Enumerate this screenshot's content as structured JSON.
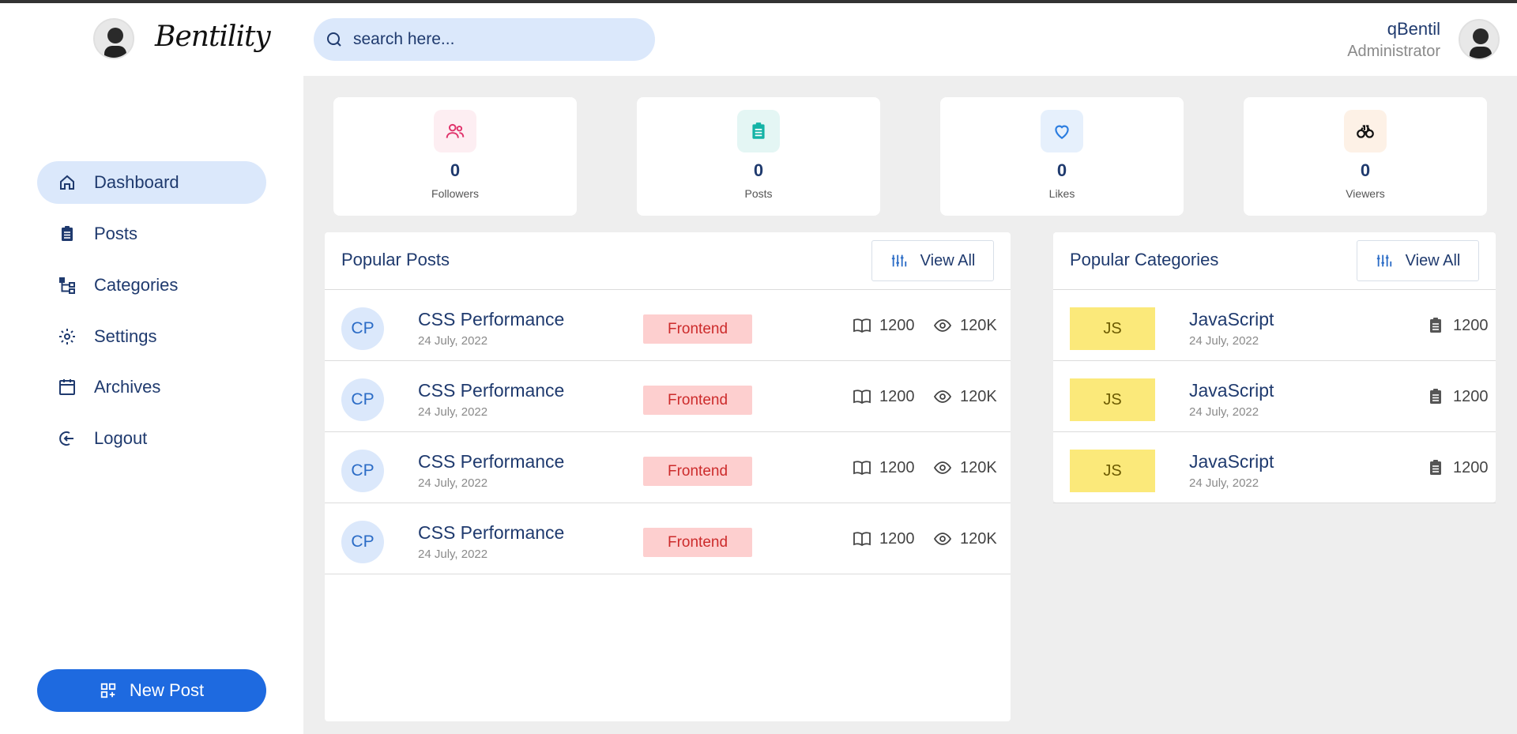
{
  "brand": {
    "name": "Bentility"
  },
  "search": {
    "placeholder": "search here..."
  },
  "user": {
    "name": "qBentil",
    "role": "Administrator"
  },
  "sidebar": {
    "items": [
      {
        "label": "Dashboard",
        "icon": "home-icon",
        "active": true
      },
      {
        "label": "Posts",
        "icon": "clipboard-icon"
      },
      {
        "label": "Categories",
        "icon": "tree-icon"
      },
      {
        "label": "Settings",
        "icon": "gear-icon"
      },
      {
        "label": "Archives",
        "icon": "calendar-icon"
      },
      {
        "label": "Logout",
        "icon": "logout-icon"
      }
    ],
    "new_post_label": "New Post"
  },
  "stats": [
    {
      "value": "0",
      "label": "Followers",
      "icon": "users-icon",
      "color": "#e0336b",
      "bg": "#fdeef2"
    },
    {
      "value": "0",
      "label": "Posts",
      "icon": "clipboard-icon",
      "color": "#14b3a6",
      "bg": "#e4f6f4"
    },
    {
      "value": "0",
      "label": "Likes",
      "icon": "heart-icon",
      "color": "#2b7de0",
      "bg": "#e6f0fc"
    },
    {
      "value": "0",
      "label": "Viewers",
      "icon": "binoculars-icon",
      "color": "#111111",
      "bg": "#fdf1e6"
    }
  ],
  "popular_posts": {
    "title": "Popular Posts",
    "view_all": "View All",
    "rows": [
      {
        "initials": "CP",
        "title": "CSS Performance",
        "date": "24 July, 2022",
        "tag": "Frontend",
        "reads": "1200",
        "views": "120K"
      },
      {
        "initials": "CP",
        "title": "CSS Performance",
        "date": "24 July, 2022",
        "tag": "Frontend",
        "reads": "1200",
        "views": "120K"
      },
      {
        "initials": "CP",
        "title": "CSS Performance",
        "date": "24 July, 2022",
        "tag": "Frontend",
        "reads": "1200",
        "views": "120K"
      },
      {
        "initials": "CP",
        "title": "CSS Performance",
        "date": "24 July, 2022",
        "tag": "Frontend",
        "reads": "1200",
        "views": "120K"
      }
    ]
  },
  "popular_categories": {
    "title": "Popular Categories",
    "view_all": "View All",
    "rows": [
      {
        "badge": "JS",
        "title": "JavaScript",
        "date": "24 July, 2022",
        "count": "1200"
      },
      {
        "badge": "JS",
        "title": "JavaScript",
        "date": "24 July, 2022",
        "count": "1200"
      },
      {
        "badge": "JS",
        "title": "JavaScript",
        "date": "24 July, 2022",
        "count": "1200"
      }
    ]
  },
  "colors": {
    "accent": "#1e6ae0",
    "nav_active_bg": "#dbe8fb",
    "text_primary": "#1f3a6e",
    "tag_bg": "#fdcfcf",
    "tag_text": "#cc2b2b",
    "js_bg": "#fbe97a"
  }
}
